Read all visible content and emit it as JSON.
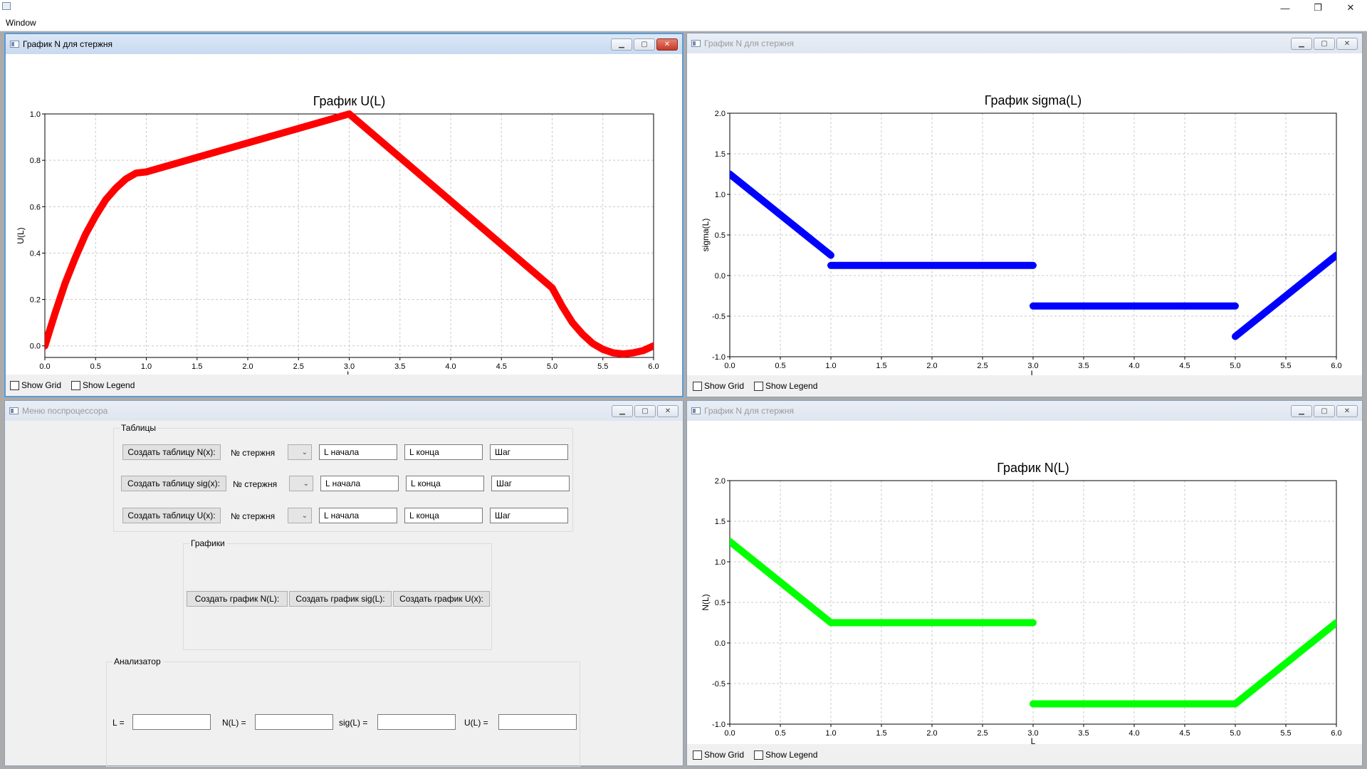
{
  "app": {
    "title": "",
    "menu": [
      "Window"
    ],
    "controls": {
      "minimize": "—",
      "restore": "❐",
      "close": "✕"
    }
  },
  "windows": {
    "u_plot": {
      "title": "График N для стержня",
      "checkboxes": {
        "grid": "Show Grid",
        "legend": "Show Legend"
      }
    },
    "sigma_plot": {
      "title": "График N для стержня",
      "checkboxes": {
        "grid": "Show Grid",
        "legend": "Show Legend"
      }
    },
    "n_plot": {
      "title": "График N для стержня",
      "checkboxes": {
        "grid": "Show Grid",
        "legend": "Show Legend"
      }
    },
    "menu": {
      "title": "Меню поспроцессора",
      "tables": {
        "title": "Таблицы",
        "rows": [
          {
            "button": "Создать таблицу N(x):",
            "rod_label": "№ стержня",
            "start": "L начала",
            "end": "L конца",
            "step": "Шаг"
          },
          {
            "button": "Создать таблицу sig(x):",
            "rod_label": "№ стержня",
            "start": "L начала",
            "end": "L конца",
            "step": "Шаг"
          },
          {
            "button": "Создать таблицу U(x):",
            "rod_label": "№ стержня",
            "start": "L начала",
            "end": "L конца",
            "step": "Шаг"
          }
        ]
      },
      "graphs": {
        "title": "Графики",
        "buttons": [
          "Создать график N(L):",
          "Создать график sig(L):",
          "Создать график U(x):"
        ]
      },
      "analyzer": {
        "title": "Анализатор",
        "labels": [
          "L =",
          "N(L) =",
          "sig(L) =",
          "U(L) ="
        ]
      }
    }
  },
  "chart_data": [
    {
      "type": "line",
      "title": "График U(L)",
      "xlabel": "L",
      "ylabel": "U(L)",
      "xlim": [
        0,
        6
      ],
      "ylim": [
        -0.05,
        1.0
      ],
      "xticks": [
        "0.0",
        "0.5",
        "1.0",
        "1.5",
        "2.0",
        "2.5",
        "3.0",
        "3.5",
        "4.0",
        "4.5",
        "5.0",
        "5.5",
        "6.0"
      ],
      "yticks": [
        "0.0",
        "0.2",
        "0.4",
        "0.6",
        "0.8",
        "1.0"
      ],
      "grid": true,
      "color": "#ff0000",
      "series": [
        {
          "x": [
            0,
            0.1,
            0.2,
            0.3,
            0.4,
            0.5,
            0.6,
            0.7,
            0.8,
            0.9,
            1.0,
            3.0,
            5.0,
            5.1,
            5.2,
            5.3,
            5.4,
            5.5,
            5.6,
            5.7,
            5.8,
            5.9,
            6.0
          ],
          "y": [
            0,
            0.14,
            0.27,
            0.38,
            0.48,
            0.56,
            0.63,
            0.68,
            0.72,
            0.745,
            0.75,
            1.0,
            0.25,
            0.17,
            0.1,
            0.05,
            0.01,
            -0.015,
            -0.03,
            -0.035,
            -0.03,
            -0.02,
            0.0
          ]
        }
      ]
    },
    {
      "type": "line",
      "title": "График sigma(L)",
      "xlabel": "L",
      "ylabel": "sigma(L)",
      "xlim": [
        0,
        6
      ],
      "ylim": [
        -1.0,
        2.0
      ],
      "xticks": [
        "0.0",
        "0.5",
        "1.0",
        "1.5",
        "2.0",
        "2.5",
        "3.0",
        "3.5",
        "4.0",
        "4.5",
        "5.0",
        "5.5",
        "6.0"
      ],
      "yticks": [
        "-1.0",
        "-0.5",
        "0.0",
        "0.5",
        "1.0",
        "1.5",
        "2.0"
      ],
      "grid": true,
      "color": "#0000ff",
      "series": [
        {
          "x": [
            0,
            1
          ],
          "y": [
            1.25,
            0.25
          ]
        },
        {
          "x": [
            1,
            3
          ],
          "y": [
            0.125,
            0.125
          ]
        },
        {
          "x": [
            3,
            5
          ],
          "y": [
            -0.375,
            -0.375
          ]
        },
        {
          "x": [
            5,
            6
          ],
          "y": [
            -0.75,
            0.25
          ]
        }
      ]
    },
    {
      "type": "line",
      "title": "График N(L)",
      "xlabel": "L",
      "ylabel": "N(L)",
      "xlim": [
        0,
        6
      ],
      "ylim": [
        -1.0,
        2.0
      ],
      "xticks": [
        "0.0",
        "0.5",
        "1.0",
        "1.5",
        "2.0",
        "2.5",
        "3.0",
        "3.5",
        "4.0",
        "4.5",
        "5.0",
        "5.5",
        "6.0"
      ],
      "yticks": [
        "-1.0",
        "-0.5",
        "0.0",
        "0.5",
        "1.0",
        "1.5",
        "2.0"
      ],
      "grid": true,
      "color": "#00ff00",
      "series": [
        {
          "x": [
            0,
            1,
            3
          ],
          "y": [
            1.25,
            0.25,
            0.25
          ]
        },
        {
          "x": [
            3,
            5,
            6
          ],
          "y": [
            -0.75,
            -0.75,
            0.25
          ]
        }
      ]
    }
  ]
}
